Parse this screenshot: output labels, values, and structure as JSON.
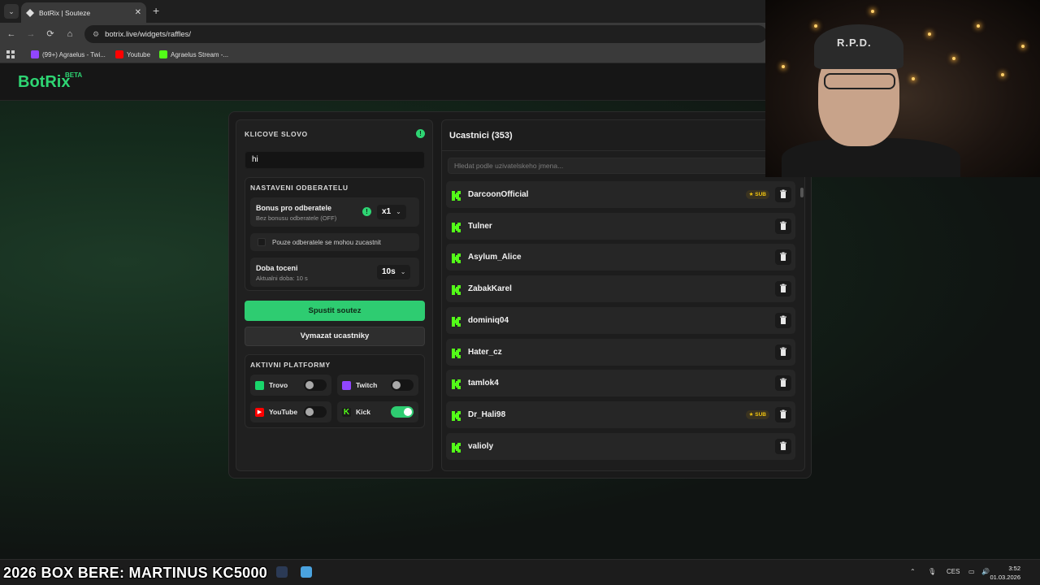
{
  "browser": {
    "tab_title": "BotRix | Souteze",
    "url": "botrix.live/widgets/raffles/",
    "bookmarks": [
      {
        "label": "(99+) Agraelus - Twi...",
        "color": "#9146ff"
      },
      {
        "label": "Youtube",
        "color": "#ff0000"
      },
      {
        "label": "Agraelus Stream -...",
        "color": "#53fc18"
      }
    ]
  },
  "site": {
    "logo": "BotRix",
    "logo_badge": "BETA"
  },
  "keyword": {
    "title": "KLICOVE SLOVO",
    "value": "hi"
  },
  "subscribers": {
    "title": "NASTAVENI ODBERATELU",
    "bonus_title": "Bonus pro odberatele",
    "bonus_sub": "Bez bonusu odberatele (OFF)",
    "bonus_value": "x1",
    "only_subs_label": "Pouze odberatele se mohou zucastnit",
    "spin_title": "Doba toceni",
    "spin_sub": "Aktualni doba: 10 s",
    "spin_value": "10s"
  },
  "actions": {
    "start": "Spustit soutez",
    "clear": "Vymazat ucastniky"
  },
  "platforms": {
    "title": "AKTIVNI PLATFORMY",
    "items": [
      {
        "name": "Trovo",
        "enabled": false,
        "color": "#19d66b"
      },
      {
        "name": "Twitch",
        "enabled": false,
        "color": "#9146ff"
      },
      {
        "name": "YouTube",
        "enabled": false,
        "color": "#ff0000"
      },
      {
        "name": "Kick",
        "enabled": true,
        "color": "#53fc18"
      }
    ]
  },
  "participants": {
    "title": "Ucastnici (353)",
    "search_placeholder": "Hledat podle uzivatelskeho jmena...",
    "sub_badge": "SUB",
    "list": [
      {
        "name": "DarcoonOfficial",
        "sub": true
      },
      {
        "name": "Tulner",
        "sub": false
      },
      {
        "name": "Asylum_Alice",
        "sub": false
      },
      {
        "name": "ZabakKarel",
        "sub": false
      },
      {
        "name": "dominiq04",
        "sub": false
      },
      {
        "name": "Hater_cz",
        "sub": false
      },
      {
        "name": "tamlok4",
        "sub": false
      },
      {
        "name": "Dr_Hali98",
        "sub": true
      },
      {
        "name": "valioly",
        "sub": false
      }
    ]
  },
  "webcam": {
    "cap_text": "R.P.D."
  },
  "taskbar": {
    "ticker": "2026 BOX BERE: MARTINUS KC5000",
    "lang": "CES",
    "time": "3:52",
    "date": "01.03.2026"
  },
  "colors": {
    "accent": "#2ecc71",
    "kick": "#53fc18",
    "sub_gold": "#f1c40f"
  }
}
